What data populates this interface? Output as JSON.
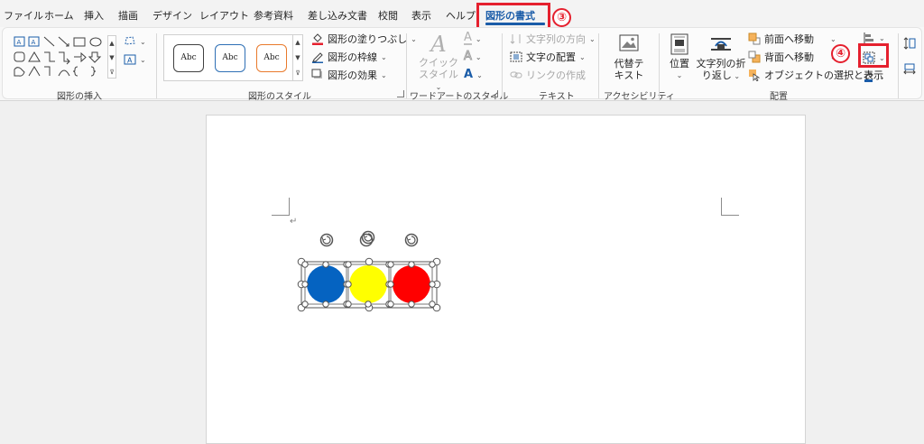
{
  "tabs": [
    {
      "label": "ファイル"
    },
    {
      "label": "ホーム"
    },
    {
      "label": "挿入"
    },
    {
      "label": "描画"
    },
    {
      "label": "デザイン"
    },
    {
      "label": "レイアウト"
    },
    {
      "label": "参考資料"
    },
    {
      "label": "差し込み文書"
    },
    {
      "label": "校閲"
    },
    {
      "label": "表示"
    },
    {
      "label": "ヘルプ"
    },
    {
      "label": "図形の書式"
    }
  ],
  "annotations": {
    "step3": "③",
    "step4": "④",
    "highlight_color": "#e5202e"
  },
  "groups": {
    "insert_shapes": "図形の挿入",
    "shape_styles": "図形のスタイル",
    "wordart_styles": "ワードアートのスタイル",
    "text": "テキスト",
    "accessibility": "アクセシビリティ",
    "arrange": "配置"
  },
  "shape_styles": {
    "preview_text": "Abc",
    "fill": "図形の塗りつぶし",
    "outline": "図形の枠線",
    "effects": "図形の効果"
  },
  "wordart": {
    "quick_style_line1": "クイック",
    "quick_style_line2": "スタイル"
  },
  "text_group": {
    "direction": "文字列の方向",
    "align": "文字の配置",
    "link": "リンクの作成"
  },
  "accessibility": {
    "alt_text_line1": "代替テ",
    "alt_text_line2": "キスト"
  },
  "arrange": {
    "position": "位置",
    "wrap_line1": "文字列の折",
    "wrap_line2": "り返し",
    "bring_forward": "前面へ移動",
    "send_backward": "背面へ移動",
    "selection_pane": "オブジェクトの選択と表示"
  },
  "document": {
    "para_mark": "↵",
    "circle_colors": [
      "#0563c1",
      "#ffff00",
      "#ff0000"
    ]
  },
  "colors": {
    "accent": "#1a5ca8",
    "page": "#ffffff",
    "canvas": "#f0f0f0"
  }
}
